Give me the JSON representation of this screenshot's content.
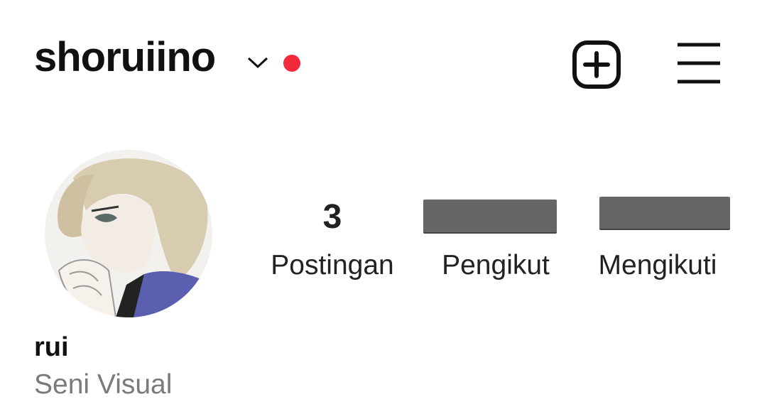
{
  "header": {
    "username": "shoruiino",
    "icons": {
      "dropdown": "chevron-down-icon",
      "notification": "red-dot-indicator",
      "create": "add-square-icon",
      "menu": "hamburger-menu-icon"
    },
    "colors": {
      "notification_dot": "#f22a3c"
    }
  },
  "profile": {
    "display_name": "rui",
    "category": "Seni Visual"
  },
  "stats": {
    "posts": {
      "value": "3",
      "label": "Postingan"
    },
    "followers": {
      "value": "",
      "label": "Pengikut"
    },
    "following": {
      "value": "",
      "label": "Mengikuti"
    }
  }
}
